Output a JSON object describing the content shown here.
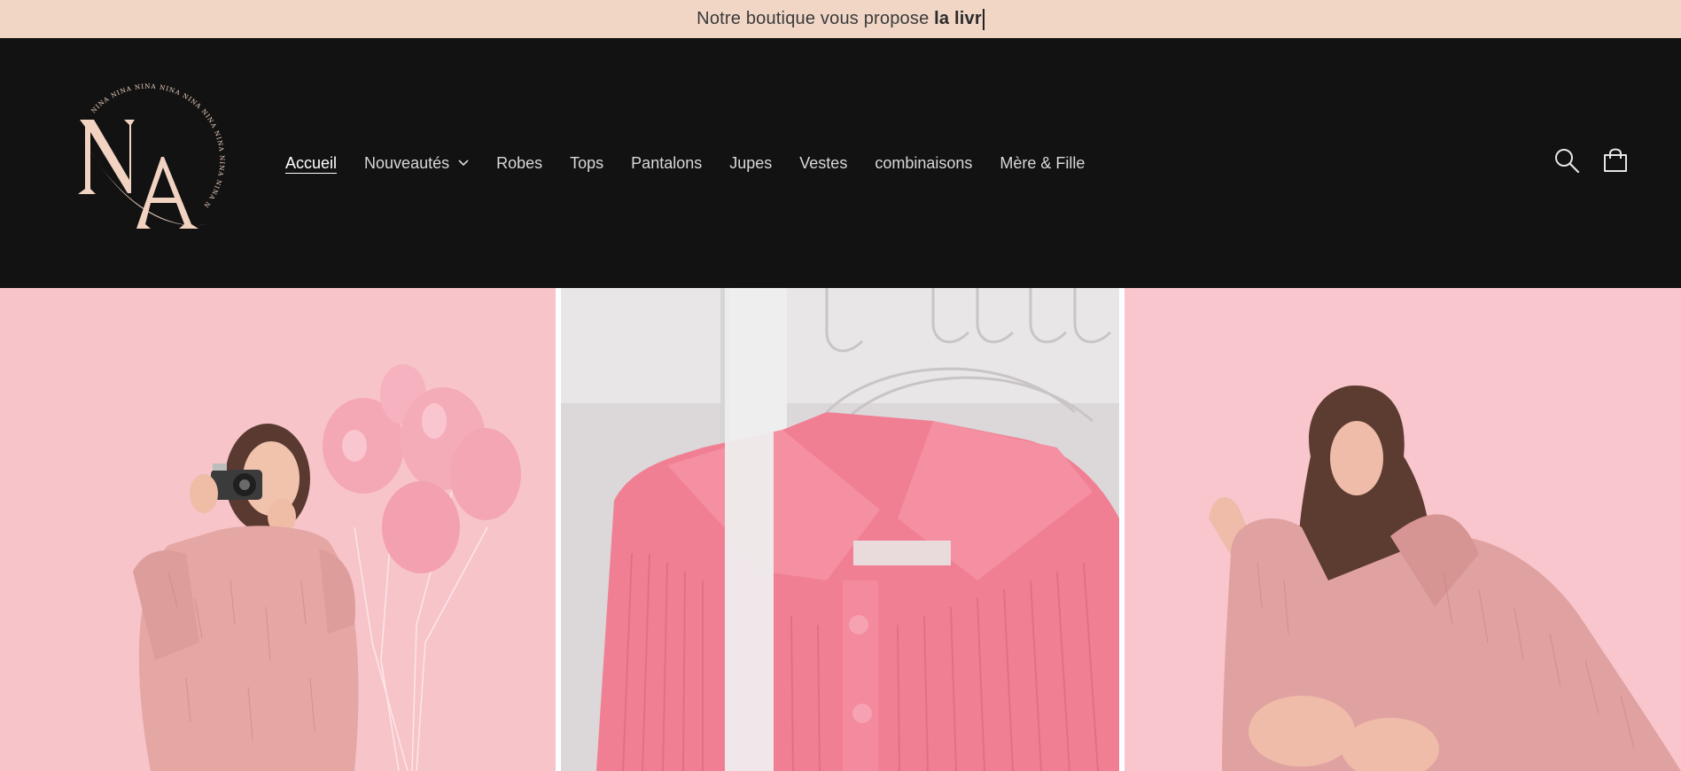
{
  "announcement": {
    "text_regular": "Notre boutique vous propose ",
    "text_bold": "la livr"
  },
  "brand": {
    "logo_monogram": "NA",
    "logo_ring_text": "NINA NINA NINA NINA NINA NINA NINA"
  },
  "nav": {
    "items": [
      {
        "label": "Accueil",
        "active": true
      },
      {
        "label": "Nouveautés",
        "has_dropdown": true
      },
      {
        "label": "Robes"
      },
      {
        "label": "Tops"
      },
      {
        "label": "Pantalons"
      },
      {
        "label": "Jupes"
      },
      {
        "label": "Vestes"
      },
      {
        "label": "combinaisons"
      },
      {
        "label": "Mère & Fille"
      }
    ]
  },
  "header_icons": {
    "search": "search-icon",
    "cart": "cart-icon"
  },
  "colors": {
    "announcement_bg": "#f1d6c6",
    "header_bg": "#121212",
    "logo": "#f2d3c2",
    "hero_pink": "#f7c4ca"
  },
  "gallery": {
    "panels": [
      {
        "subject": "woman-with-camera-and-pink-balloons"
      },
      {
        "subject": "pink-ribbed-cardigan-on-hanger"
      },
      {
        "subject": "woman-in-pink-faux-fur-coat"
      }
    ]
  }
}
